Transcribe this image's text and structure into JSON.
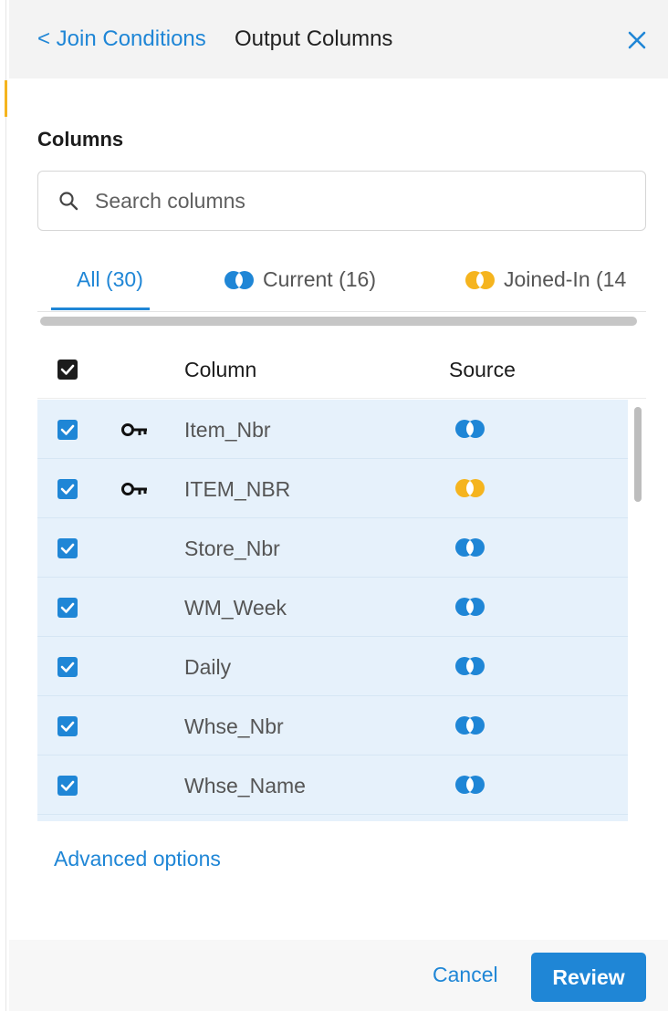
{
  "colors": {
    "accent": "#1f86d6",
    "current_source": "#1f86d6",
    "joined_source": "#f5b41e",
    "row_selected_bg": "#e6f1fb"
  },
  "header": {
    "back_label": "< Join Conditions",
    "title": "Output Columns",
    "close_icon": "close-icon"
  },
  "columns_section": {
    "label": "Columns",
    "search_placeholder": "Search columns",
    "search_value": ""
  },
  "tabs": [
    {
      "label": "All (30)",
      "active": true,
      "source": null
    },
    {
      "label": "Current (16)",
      "active": false,
      "source": "current"
    },
    {
      "label": "Joined-In (14",
      "active": false,
      "source": "joined"
    }
  ],
  "table": {
    "header": {
      "select_all_checked": true,
      "column": "Column",
      "source": "Source"
    },
    "rows": [
      {
        "checked": true,
        "key": true,
        "name": "Item_Nbr",
        "source": "current"
      },
      {
        "checked": true,
        "key": true,
        "name": "ITEM_NBR",
        "source": "joined"
      },
      {
        "checked": true,
        "key": false,
        "name": "Store_Nbr",
        "source": "current"
      },
      {
        "checked": true,
        "key": false,
        "name": "WM_Week",
        "source": "current"
      },
      {
        "checked": true,
        "key": false,
        "name": "Daily",
        "source": "current"
      },
      {
        "checked": true,
        "key": false,
        "name": "Whse_Nbr",
        "source": "current"
      },
      {
        "checked": true,
        "key": false,
        "name": "Whse_Name",
        "source": "current"
      }
    ]
  },
  "advanced_label": "Advanced options",
  "footer": {
    "cancel_label": "Cancel",
    "review_label": "Review"
  }
}
